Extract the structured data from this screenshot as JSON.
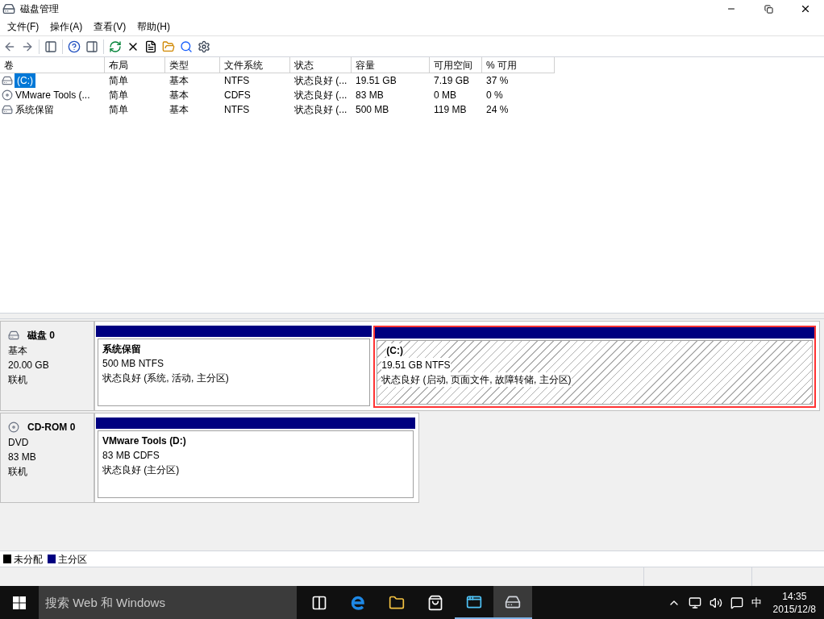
{
  "window": {
    "title": "磁盘管理"
  },
  "menu": [
    {
      "label": "文件(F)"
    },
    {
      "label": "操作(A)"
    },
    {
      "label": "查看(V)"
    },
    {
      "label": "帮助(H)"
    }
  ],
  "table": {
    "columns": [
      "卷",
      "布局",
      "类型",
      "文件系统",
      "状态",
      "容量",
      "可用空间",
      "% 可用"
    ],
    "rows": [
      {
        "kind": "disk",
        "selected": true,
        "cells": [
          "(C:)",
          "简单",
          "基本",
          "NTFS",
          "状态良好 (...",
          "19.51 GB",
          "7.19 GB",
          "37 %"
        ]
      },
      {
        "kind": "cdrom",
        "selected": false,
        "cells": [
          "VMware Tools (...",
          "简单",
          "基本",
          "CDFS",
          "状态良好 (...",
          "83 MB",
          "0 MB",
          "0 %"
        ]
      },
      {
        "kind": "disk",
        "selected": false,
        "cells": [
          "系统保留",
          "简单",
          "基本",
          "NTFS",
          "状态良好 (...",
          "500 MB",
          "119 MB",
          "24 %"
        ]
      }
    ]
  },
  "disks": [
    {
      "kind": "disk",
      "name": "磁盘 0",
      "type": "基本",
      "size": "20.00 GB",
      "state": "联机",
      "partitions": [
        {
          "name": "系统保留",
          "size": "500 MB NTFS",
          "status": "状态良好 (系统, 活动, 主分区)",
          "selected": false
        },
        {
          "name": "(C:)",
          "size": "19.51 GB NTFS",
          "status": "状态良好 (启动, 页面文件, 故障转储, 主分区)",
          "selected": true
        }
      ]
    },
    {
      "kind": "cdrom",
      "name": "CD-ROM 0",
      "type": "DVD",
      "size": "83 MB",
      "state": "联机",
      "partitions": [
        {
          "name": "VMware Tools  (D:)",
          "size": "83 MB CDFS",
          "status": "状态良好 (主分区)",
          "selected": false
        }
      ]
    }
  ],
  "legend": [
    {
      "label": "未分配",
      "color": "#000000"
    },
    {
      "label": "主分区",
      "color": "#000080"
    }
  ],
  "taskbar": {
    "search": {
      "placeholder": "搜索 Web 和 Windows"
    },
    "apps": [
      {
        "kind": "taskview",
        "running": false,
        "selected": false
      },
      {
        "kind": "edge",
        "running": false,
        "selected": false
      },
      {
        "kind": "explorer",
        "running": false,
        "selected": false
      },
      {
        "kind": "store",
        "running": false,
        "selected": false
      },
      {
        "kind": "app",
        "running": true,
        "selected": false
      },
      {
        "kind": "disk",
        "running": true,
        "selected": true
      }
    ],
    "ime": "中",
    "time": "14:35",
    "date": "2015/12/8"
  }
}
